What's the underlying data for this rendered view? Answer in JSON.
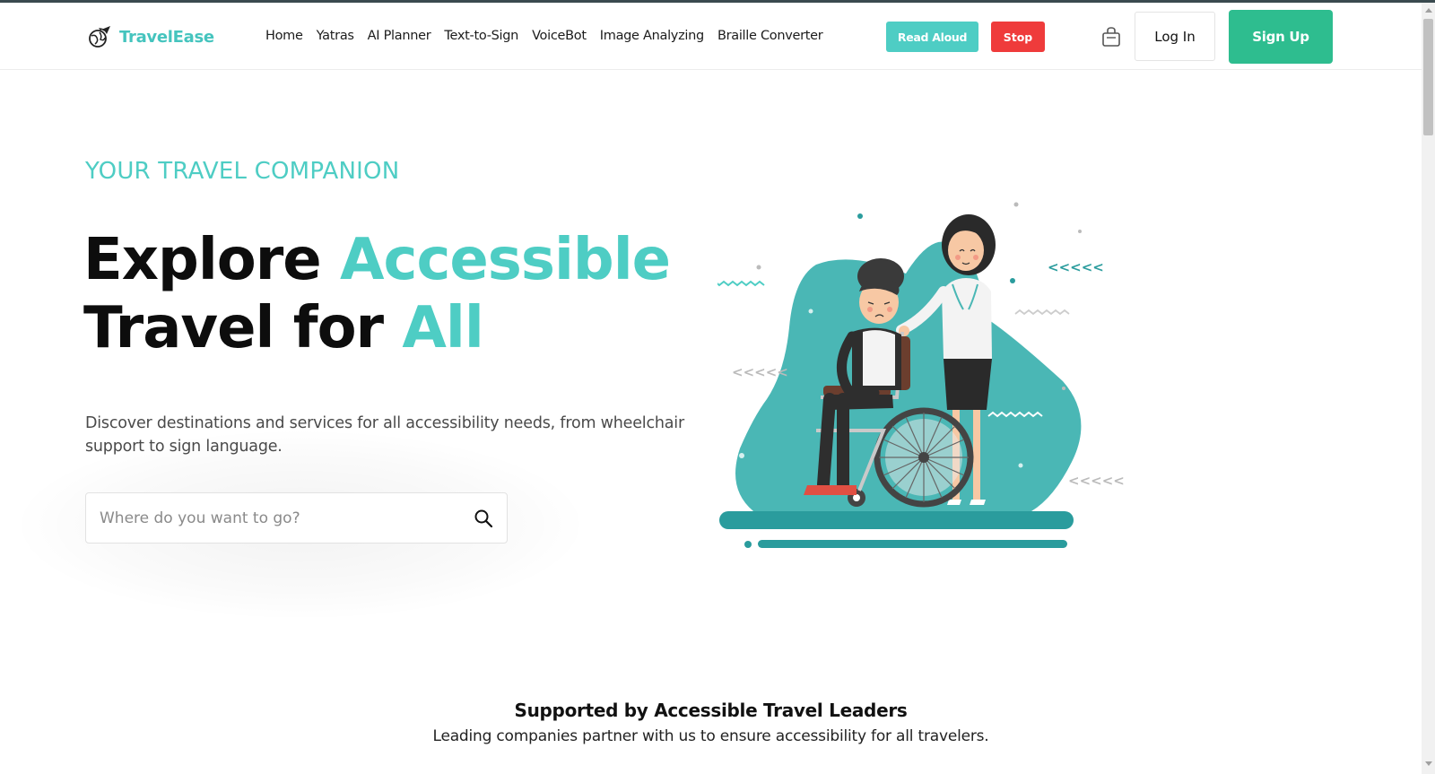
{
  "brand": {
    "name": "TravelEase",
    "accent": "#4ecdc4"
  },
  "nav": {
    "items": [
      {
        "label": "Home"
      },
      {
        "label": "Yatras"
      },
      {
        "label": "AI Planner"
      },
      {
        "label": "Text-to-Sign"
      },
      {
        "label": "VoiceBot"
      },
      {
        "label": "Image Analyzing"
      },
      {
        "label": "Braille Converter"
      }
    ]
  },
  "toolbar": {
    "read_aloud_label": "Read Aloud",
    "stop_label": "Stop",
    "cart_icon": "shopping-bag-icon",
    "login_label": "Log In",
    "signup_label": "Sign Up",
    "read_aloud_color": "#4ecdc4",
    "stop_color": "#ef3b3b",
    "signup_color": "#2ebd8f"
  },
  "hero": {
    "eyebrow": "YOUR TRAVEL COMPANION",
    "headline_part1": "Explore ",
    "headline_accent1": "Accessible",
    "headline_part2": "Travel for ",
    "headline_accent2": "All",
    "description": "Discover destinations and services for all accessibility needs, from wheelchair support to sign language.",
    "search": {
      "placeholder": "Where do you want to go?",
      "value": "",
      "icon": "search-icon"
    },
    "illustration": "nurse-pushing-wheelchair-illustration"
  },
  "supported": {
    "title": "Supported by Accessible Travel Leaders",
    "subtitle": "Leading companies partner with us to ensure accessibility for all travelers."
  }
}
